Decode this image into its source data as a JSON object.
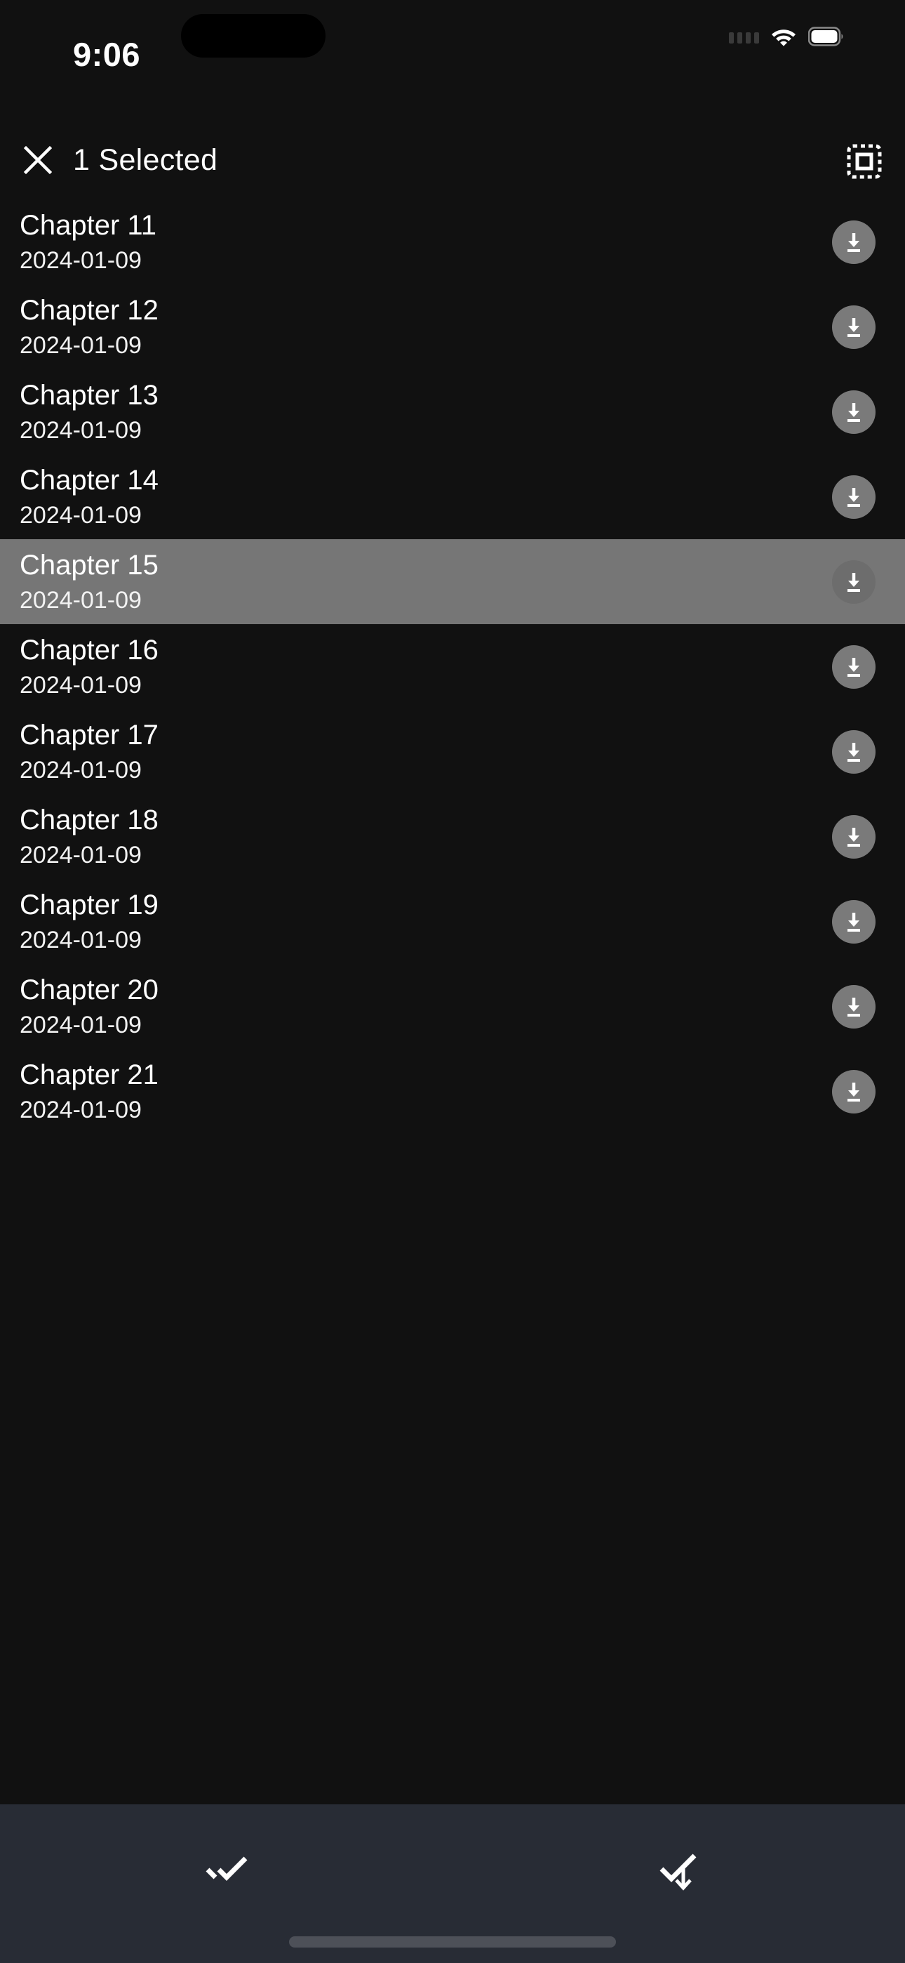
{
  "status_bar": {
    "time": "9:06",
    "signal_icon": "signal-dots-icon",
    "wifi_icon": "wifi-icon",
    "battery_icon": "battery-full-icon"
  },
  "header": {
    "close_icon": "close-icon",
    "title": "1 Selected",
    "range_select_icon": "select-range-icon"
  },
  "list": {
    "download_icon": "download-icon",
    "rows": [
      {
        "title": "Chapter 11",
        "date": "2024-01-09",
        "selected": false
      },
      {
        "title": "Chapter 12",
        "date": "2024-01-09",
        "selected": false
      },
      {
        "title": "Chapter 13",
        "date": "2024-01-09",
        "selected": false
      },
      {
        "title": "Chapter 14",
        "date": "2024-01-09",
        "selected": false
      },
      {
        "title": "Chapter 15",
        "date": "2024-01-09",
        "selected": true
      },
      {
        "title": "Chapter 16",
        "date": "2024-01-09",
        "selected": false
      },
      {
        "title": "Chapter 17",
        "date": "2024-01-09",
        "selected": false
      },
      {
        "title": "Chapter 18",
        "date": "2024-01-09",
        "selected": false
      },
      {
        "title": "Chapter 19",
        "date": "2024-01-09",
        "selected": false
      },
      {
        "title": "Chapter 20",
        "date": "2024-01-09",
        "selected": false
      },
      {
        "title": "Chapter 21",
        "date": "2024-01-09",
        "selected": false
      }
    ]
  },
  "toolbar": {
    "mark_all_icon": "double-check-icon",
    "select_below_icon": "check-arrow-down-icon",
    "home_indicator": "home-indicator"
  },
  "colors": {
    "background": "#111111",
    "selected_row": "#767676",
    "toolbar_background": "#282c35",
    "download_button": "#7a7a7a",
    "text_primary": "#ffffff",
    "home_indicator": "#4d5058"
  }
}
